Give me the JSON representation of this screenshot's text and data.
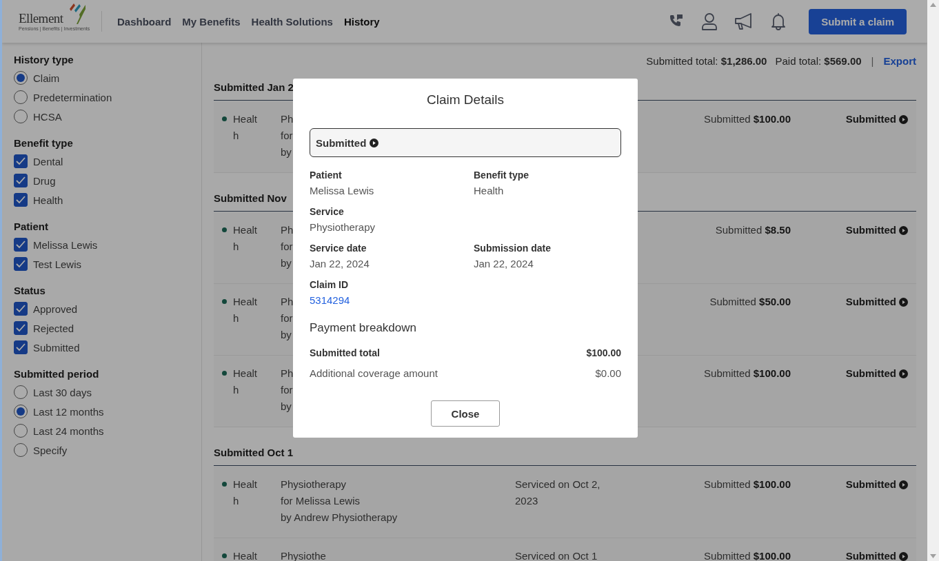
{
  "header": {
    "logo": {
      "name": "Ellement",
      "tagline": "Pensions | Benefits | Investments"
    },
    "nav": [
      {
        "label": "Dashboard",
        "selected": false
      },
      {
        "label": "My Benefits",
        "selected": false
      },
      {
        "label": "Health Solutions",
        "selected": false
      },
      {
        "label": "History",
        "selected": true
      }
    ],
    "submit_button": "Submit a claim"
  },
  "filters": [
    {
      "title": "History type",
      "kind": "radio",
      "options": [
        {
          "label": "Claim",
          "selected": true
        },
        {
          "label": "Predetermination",
          "selected": false
        },
        {
          "label": "HCSA",
          "selected": false
        }
      ]
    },
    {
      "title": "Benefit type",
      "kind": "checkbox",
      "options": [
        {
          "label": "Dental",
          "checked": true
        },
        {
          "label": "Drug",
          "checked": true
        },
        {
          "label": "Health",
          "checked": true
        }
      ]
    },
    {
      "title": "Patient",
      "kind": "checkbox",
      "options": [
        {
          "label": "Melissa Lewis",
          "checked": true
        },
        {
          "label": "Test Lewis",
          "checked": true
        }
      ]
    },
    {
      "title": "Status",
      "kind": "checkbox",
      "options": [
        {
          "label": "Approved",
          "checked": true
        },
        {
          "label": "Rejected",
          "checked": true
        },
        {
          "label": "Submitted",
          "checked": true
        }
      ]
    },
    {
      "title": "Submitted period",
      "kind": "radio",
      "options": [
        {
          "label": "Last 30 days",
          "selected": false
        },
        {
          "label": "Last 12 months",
          "selected": true
        },
        {
          "label": "Last 24 months",
          "selected": false
        },
        {
          "label": "Specify",
          "selected": false
        }
      ]
    }
  ],
  "totals": {
    "submitted": "Submitted total: **$1,286.00**",
    "paid": "Paid total: **$569.00**",
    "separator": "|",
    "export": "Export"
  },
  "groups": [
    {
      "title": "Submitted Jan 2",
      "rows": [
        {
          "category": "Health",
          "description": [
            "Ph",
            "for",
            "by"
          ],
          "amount": "Submitted **$100.00**",
          "status": "Submitted"
        }
      ]
    },
    {
      "title": "Submitted Nov",
      "rows": [
        {
          "category": "Health",
          "description": [
            "Ph",
            "for",
            "by"
          ],
          "amount": "Submitted **$8.50**",
          "status": "Submitted"
        },
        {
          "category": "Health",
          "description": [
            "Ph",
            "for",
            "by"
          ],
          "amount": "Submitted **$50.00**",
          "status": "Submitted"
        },
        {
          "category": "Health",
          "description": [
            "Ph",
            "for",
            "by"
          ],
          "amount": "Submitted **$100.00**",
          "status": "Submitted"
        }
      ]
    },
    {
      "title": "Submitted Oct 1",
      "rows": [
        {
          "category": "Health",
          "description": [
            "Physiotherapy",
            "for Melissa Lewis",
            "by Andrew Physiotherapy"
          ],
          "date": "Serviced on Oct 2, 2023",
          "amount": "Submitted **$100.00**",
          "status": "Submitted"
        },
        {
          "category": "Healt",
          "description": [
            "Physiothe"
          ],
          "date": "Serviced on Oct 1",
          "amount": "Submitted **$100.00**",
          "status": "Submitted"
        }
      ]
    }
  ],
  "modal": {
    "title": "Claim Details",
    "status": "Submitted",
    "fields": [
      {
        "label": "Patient",
        "value": "Melissa Lewis"
      },
      {
        "label": "Benefit type",
        "value": "Health"
      },
      {
        "label": "Service",
        "value": "Physiotherapy"
      },
      {
        "label": "Service date",
        "value": "Jan 22, 2024"
      },
      {
        "label": "Submission date",
        "value": "Jan 22, 2024"
      },
      {
        "label": "Claim ID",
        "value": "5314294",
        "kind": "link"
      }
    ],
    "payment_title": "Payment breakdown",
    "payment": [
      {
        "label": "Submitted total",
        "value": "$100.00",
        "kind": "total"
      },
      {
        "label": "Additional coverage amount",
        "value": "$0.00",
        "kind": "line"
      }
    ],
    "close_button": "Close"
  }
}
